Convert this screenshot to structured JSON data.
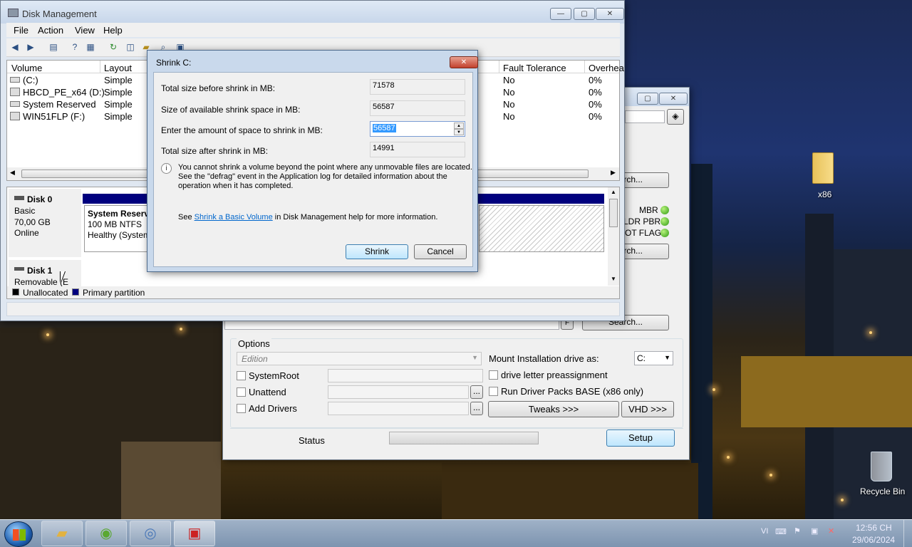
{
  "disk_mgmt": {
    "title": "Disk Management",
    "menu": [
      "File",
      "Action",
      "View",
      "Help"
    ],
    "columns": [
      "Volume",
      "Layout",
      "Fault Tolerance",
      "Overhea"
    ],
    "volumes": [
      {
        "name": "(C:)",
        "layout": "Simple",
        "fault": "No",
        "overhead": "0%"
      },
      {
        "name": "HBCD_PE_x64 (D:)",
        "layout": "Simple",
        "fault": "No",
        "overhead": "0%"
      },
      {
        "name": "System Reserved",
        "layout": "Simple",
        "fault": "No",
        "overhead": "0%"
      },
      {
        "name": "WIN51FLP (F:)",
        "layout": "Simple",
        "fault": "No",
        "overhead": "0%"
      }
    ],
    "disk0": {
      "name": "Disk 0",
      "type": "Basic",
      "size": "70,00 GB",
      "status": "Online",
      "partition": {
        "name": "System Reserv",
        "size": "100 MB NTFS",
        "status": "Healthy (System"
      }
    },
    "disk1": {
      "name": "Disk 1",
      "type": "Removable (E"
    },
    "legend": {
      "unallocated": "Unallocated",
      "primary": "Primary partition",
      "unallocated_color": "#000000",
      "primary_color": "#00007e"
    }
  },
  "shrink": {
    "title": "Shrink C:",
    "labels": [
      "Total size before shrink in MB:",
      "Size of available shrink space in MB:",
      "Enter the amount of space to shrink in MB:",
      "Total size after shrink in MB:"
    ],
    "values": {
      "before": "71578",
      "available": "56587",
      "amount": "56587",
      "after": "14991"
    },
    "info_line1": "You cannot shrink a volume beyond the point where any unmovable files are located.",
    "info_line2": "See the \"defrag\" event in the Application log for detailed information about the",
    "info_line3": "operation when it has completed.",
    "help_pre": "See ",
    "help_link": "Shrink a Basic Volume",
    "help_post": " in Disk Management help for more information.",
    "shrink_btn": "Shrink",
    "cancel_btn": "Cancel"
  },
  "setup": {
    "search1": "Search...",
    "search2": "Search...",
    "search3": "Search...",
    "indicators": [
      "MBR",
      "LDR PBR",
      "OT FLAG"
    ],
    "f_key": "F",
    "options_title": "Options",
    "edition_placeholder": "Edition",
    "checkboxes": [
      "SystemRoot",
      "Unattend",
      "Add Drivers"
    ],
    "mount_label": "Mount Installation drive as:",
    "mount_value": "C:",
    "preassign": "drive letter preassignment",
    "driver_packs": "Run Driver Packs BASE (x86 only)",
    "tweaks_btn": "Tweaks >>>",
    "vhd_btn": "VHD >>>",
    "status_label": "Status",
    "setup_btn": "Setup",
    "browse": "..."
  },
  "desktop": {
    "folder_label": "x86",
    "recycle_label": "Recycle Bin"
  },
  "taskbar": {
    "lang": "VI",
    "time": "12:56 CH",
    "date": "29/06/2024"
  }
}
